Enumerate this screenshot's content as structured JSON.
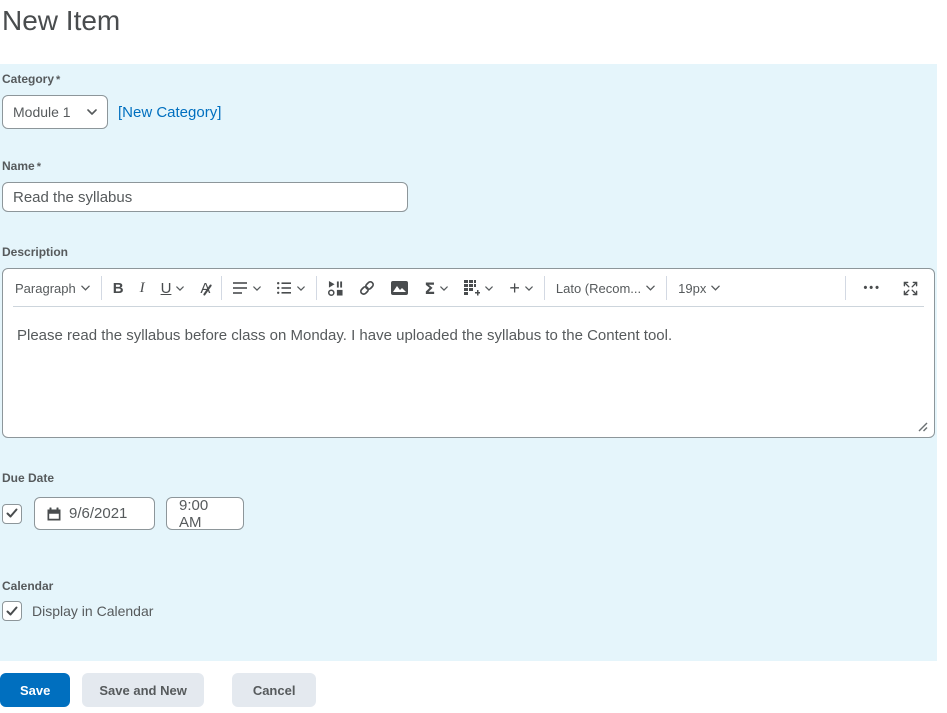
{
  "page": {
    "title": "New Item"
  },
  "form": {
    "category": {
      "label": "Category",
      "required": "*",
      "selected_option": "Module 1",
      "new_category_link": "[New Category]"
    },
    "name": {
      "label": "Name",
      "required": "*",
      "value": "Read the syllabus"
    },
    "description": {
      "label": "Description",
      "content": "Please read the syllabus before class on Monday. I have uploaded the syllabus to the Content tool.",
      "toolbar": {
        "paragraph": "Paragraph",
        "bold": "B",
        "italic": "I",
        "underline": "U",
        "font_color": "A",
        "sigma": "Σ",
        "plus": "+",
        "font_family": "Lato (Recom...",
        "font_size": "19px",
        "more_actions": "•••"
      }
    },
    "due_date": {
      "label": "Due Date",
      "checkbox_checked": true,
      "date_value": "9/6/2021",
      "time_value": "9:00 AM"
    },
    "calendar": {
      "label": "Calendar",
      "checkbox_label": "Display in Calendar",
      "checkbox_checked": true
    }
  },
  "actions": {
    "save": "Save",
    "save_and_new": "Save and New",
    "cancel": "Cancel"
  },
  "colors": {
    "primary_blue": "#006fbf",
    "panel_background": "#e5f5fb",
    "link_blue": "#006fbf",
    "heading_text": "#494c4e",
    "body_text": "#565a5c"
  }
}
